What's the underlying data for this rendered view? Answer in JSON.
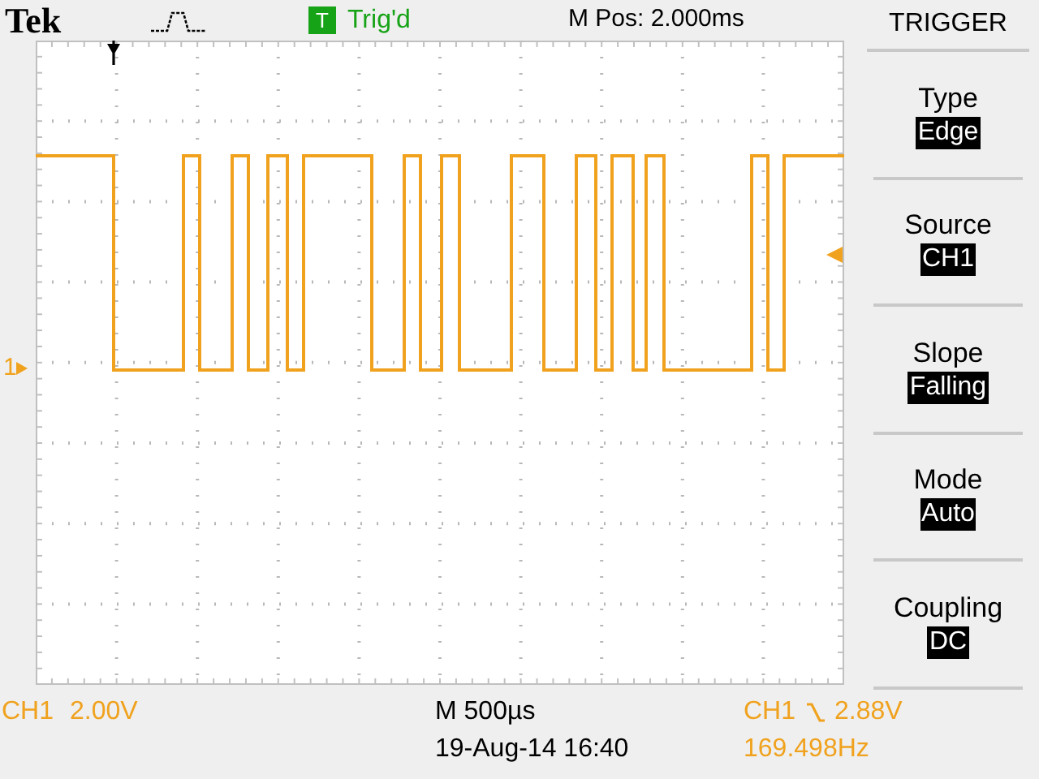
{
  "header": {
    "brand": "Tek",
    "trigger_status_letter": "T",
    "acquisition_state": "Trig'd",
    "horizontal_position": "M Pos: 2.000ms"
  },
  "channel_marker": "1",
  "menu": {
    "title": "TRIGGER",
    "items": [
      {
        "label": "Type",
        "value": "Edge"
      },
      {
        "label": "Source",
        "value": "CH1"
      },
      {
        "label": "Slope",
        "value": "Falling"
      },
      {
        "label": "Mode",
        "value": "Auto"
      },
      {
        "label": "Coupling",
        "value": "DC"
      }
    ]
  },
  "readouts": {
    "channel": "CH1",
    "volts_per_div": "2.00V",
    "timebase": "M 500µs",
    "datetime": "19-Aug-14 16:40",
    "trigger_source": "CH1",
    "trigger_level": "2.88V",
    "frequency": "169.498Hz"
  }
}
